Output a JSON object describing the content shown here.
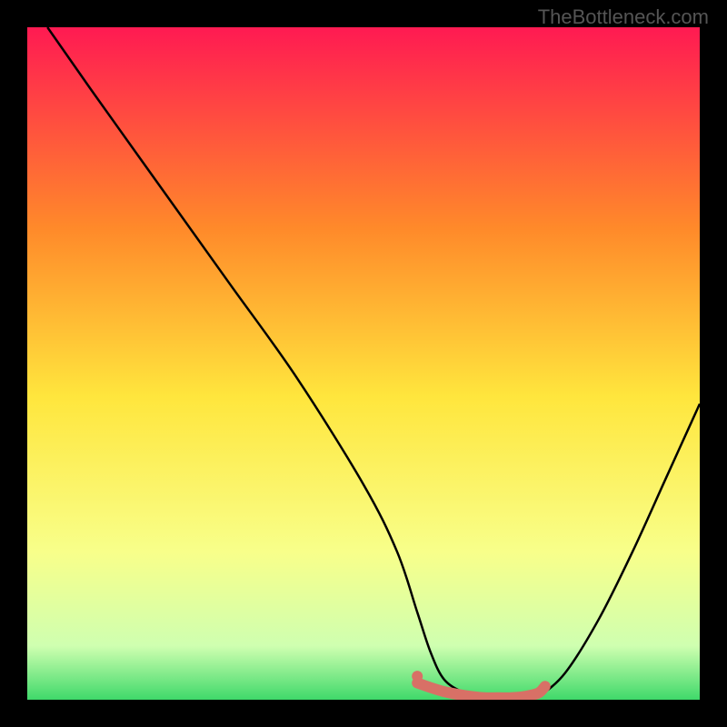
{
  "watermark": "TheBottleneck.com",
  "colors": {
    "background": "#000000",
    "gradient_top": "#ff1a52",
    "gradient_mid_upper": "#ff8a2a",
    "gradient_mid": "#ffe63d",
    "gradient_mid_lower": "#f8ff8a",
    "gradient_lower": "#cfffb0",
    "gradient_bottom": "#3fd96a",
    "curve": "#000000",
    "marker": "#d87066"
  },
  "chart_data": {
    "type": "line",
    "title": "",
    "xlabel": "",
    "ylabel": "",
    "xlim": [
      0,
      100
    ],
    "ylim": [
      0,
      100
    ],
    "series": [
      {
        "name": "bottleneck-curve",
        "x": [
          3,
          10,
          20,
          30,
          40,
          50,
          55,
          58,
          60,
          62,
          65,
          68,
          70,
          72,
          74,
          76,
          80,
          85,
          90,
          95,
          100
        ],
        "y": [
          100,
          90,
          76,
          62,
          48,
          32,
          22,
          13,
          7,
          3,
          1,
          0,
          0,
          0,
          0,
          0.5,
          4,
          12,
          22,
          33,
          44
        ]
      }
    ],
    "markers": {
      "name": "highlight-band",
      "x": [
        58,
        60,
        62,
        64,
        66,
        68,
        70,
        72,
        74,
        76,
        77
      ],
      "y": [
        2.5,
        1.8,
        1.2,
        0.8,
        0.5,
        0.3,
        0.3,
        0.3,
        0.5,
        1.0,
        2.0
      ]
    },
    "dot": {
      "x": 58,
      "y": 3.5
    }
  }
}
